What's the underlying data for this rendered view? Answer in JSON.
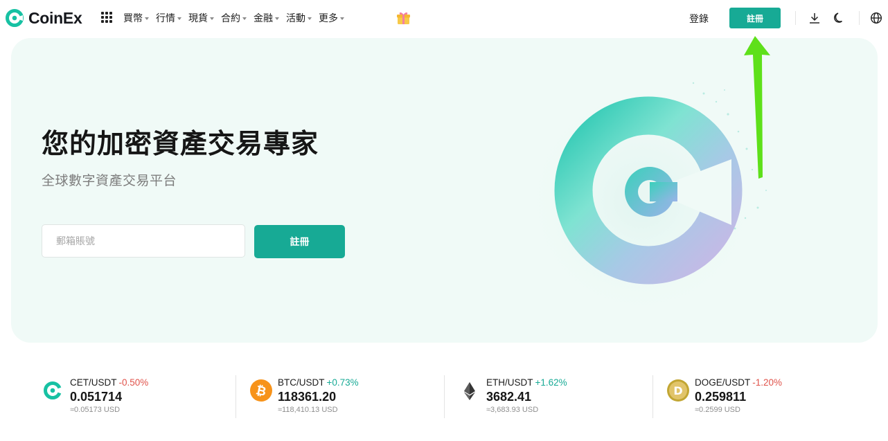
{
  "brand": {
    "name": "CoinEx"
  },
  "nav": {
    "items": [
      {
        "label": "買幣"
      },
      {
        "label": "行情"
      },
      {
        "label": "現貨"
      },
      {
        "label": "合約"
      },
      {
        "label": "金融"
      },
      {
        "label": "活動"
      },
      {
        "label": "更多"
      }
    ]
  },
  "header": {
    "login_label": "登錄",
    "register_label": "註冊"
  },
  "hero": {
    "title": "您的加密資產交易專家",
    "subtitle": "全球數字資產交易平台",
    "email_placeholder": "郵箱賬號",
    "register_label": "註冊"
  },
  "tickers": [
    {
      "pair": "CET/USDT",
      "change": "-0.50%",
      "price": "0.051714",
      "usd": "≈0.05173 USD",
      "icon": "cet-coin-icon"
    },
    {
      "pair": "BTC/USDT",
      "change": "+0.73%",
      "price": "118361.20",
      "usd": "≈118,410.13 USD",
      "icon": "btc-coin-icon"
    },
    {
      "pair": "ETH/USDT",
      "change": "+1.62%",
      "price": "3682.41",
      "usd": "≈3,683.93 USD",
      "icon": "eth-coin-icon"
    },
    {
      "pair": "DOGE/USDT",
      "change": "-1.20%",
      "price": "0.259811",
      "usd": "≈0.2599 USD",
      "icon": "doge-coin-icon"
    }
  ],
  "colors": {
    "accent": "#17aa95",
    "up": "#17aa95",
    "down": "#e0524a",
    "hero_bg": "#f0faf7",
    "annotation_arrow": "#5ee01a"
  }
}
